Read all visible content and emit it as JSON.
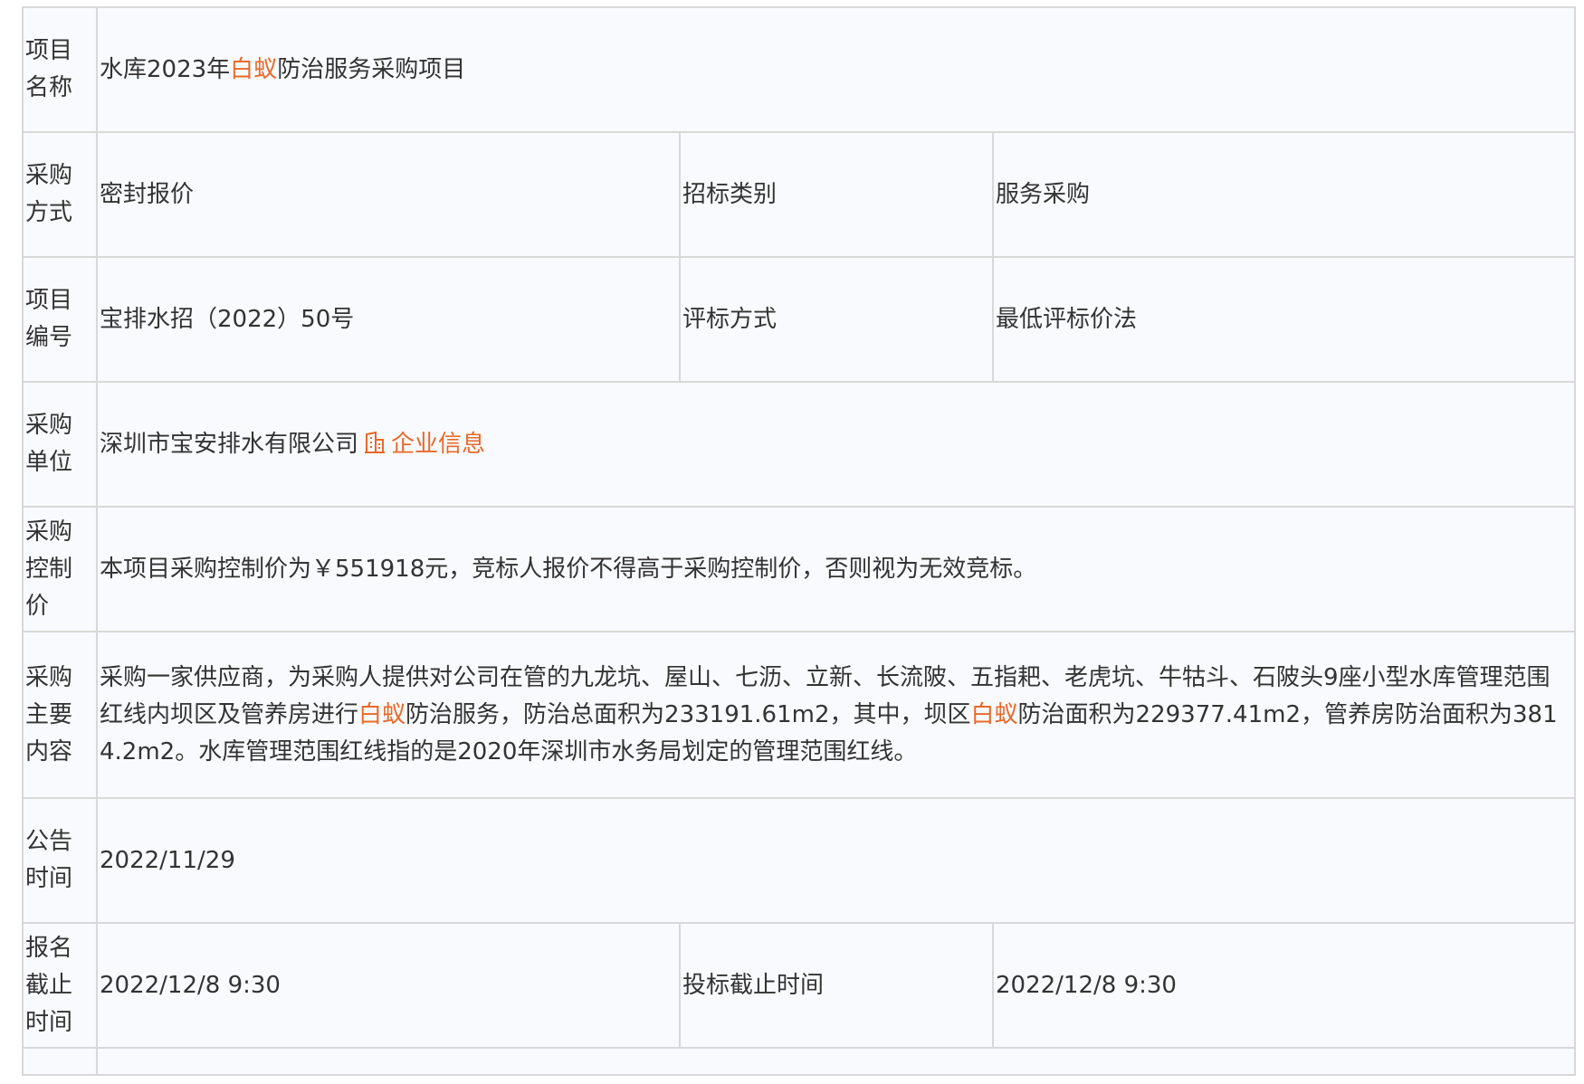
{
  "colors": {
    "highlight": "#e8692a",
    "border": "#d8d8d8",
    "cell_background": "#f9fafd",
    "text": "#333333"
  },
  "rows": {
    "project_name": {
      "label": "项目名称",
      "value_before": "水库2023年",
      "value_highlight": "白蚁",
      "value_after": "防治服务采购项目"
    },
    "procurement_method": {
      "label": "采购方式",
      "value": "密封报价",
      "label2": "招标类别",
      "value2": "服务采购"
    },
    "project_number": {
      "label": "项目编号",
      "value": "宝排水招（2022）50号",
      "label2": "评标方式",
      "value2": "最低评标价法"
    },
    "purchaser": {
      "label": "采购单位",
      "value": "深圳市宝安排水有限公司",
      "link_icon": "building-icon",
      "link_label": "企业信息"
    },
    "control_price": {
      "label": "采购控制价",
      "value": "本项目采购控制价为￥551918元，竞标人报价不得高于采购控制价，否则视为无效竞标。"
    },
    "main_content": {
      "label": "采购主要内容",
      "part1": "采购一家供应商，为采购人提供对公司在管的九龙坑、屋山、七沥、立新、长流陂、五指耙、老虎坑、牛牯斗、石陂头9座小型水库管理范围红线内坝区及管养房进行",
      "highlight1": "白蚁",
      "part2": "防治服务，防治总面积为233191.61m2，其中，坝区",
      "highlight2": "白蚁",
      "part3": "防治面积为229377.41m2，管养房防治面积为3814.2m2。水库管理范围红线指的是2020年深圳市水务局划定的管理范围红线。"
    },
    "announcement_time": {
      "label": "公告时间",
      "value": "2022/11/29"
    },
    "deadline": {
      "label": "报名截止时间",
      "value": "2022/12/8 9:30",
      "label2": "投标截止时间",
      "value2": "2022/12/8 9:30"
    }
  }
}
